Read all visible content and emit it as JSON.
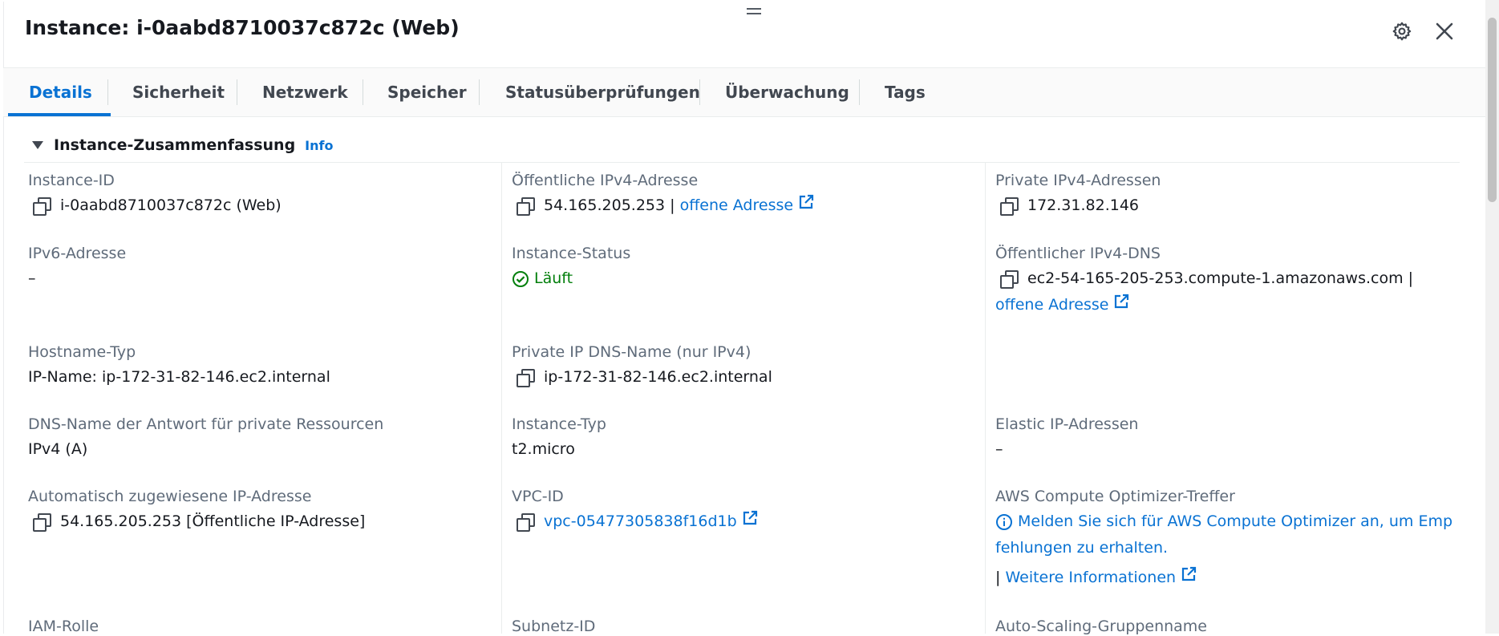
{
  "header": {
    "title": "Instance: i-0aabd8710037c872c (Web)"
  },
  "tabs": [
    {
      "label": "Details"
    },
    {
      "label": "Sicherheit"
    },
    {
      "label": "Netzwerk"
    },
    {
      "label": "Speicher"
    },
    {
      "label": "Statusüberprüfungen"
    },
    {
      "label": "Überwachung"
    },
    {
      "label": "Tags"
    }
  ],
  "section": {
    "title": "Instance-Zusammenfassung",
    "info": "Info"
  },
  "fields": {
    "instance_id": {
      "label": "Instance-ID",
      "value": "i-0aabd8710037c872c (Web)"
    },
    "public_ipv4": {
      "label": "Öffentliche IPv4-Adresse",
      "value": "54.165.205.253 |",
      "link": "offene Adresse"
    },
    "private_ipv4": {
      "label": "Private IPv4-Adressen",
      "value": "172.31.82.146"
    },
    "ipv6": {
      "label": "IPv6-Adresse",
      "value": "–"
    },
    "instance_status": {
      "label": "Instance-Status",
      "value": "Läuft"
    },
    "public_dns": {
      "label": "Öffentlicher IPv4-DNS",
      "value": "ec2-54-165-205-253.compute-1.amazonaws.com |",
      "link": "offene Adresse"
    },
    "hostname_type": {
      "label": "Hostname-Typ",
      "value": "IP-Name: ip-172-31-82-146.ec2.internal"
    },
    "private_ip_dns": {
      "label": "Private IP DNS-Name (nur IPv4)",
      "value": "ip-172-31-82-146.ec2.internal"
    },
    "dns_resource": {
      "label": "DNS-Name der Antwort für private Ressourcen",
      "value": "IPv4 (A)"
    },
    "instance_type": {
      "label": "Instance-Typ",
      "value": "t2.micro"
    },
    "elastic_ip": {
      "label": "Elastic IP-Adressen",
      "value": "–"
    },
    "auto_ip": {
      "label": "Automatisch zugewiesene IP-Adresse",
      "value": "54.165.205.253 [Öffentliche IP-Adresse]"
    },
    "vpc_id": {
      "label": "VPC-ID",
      "value": "vpc-05477305838f16d1b"
    },
    "optimizer": {
      "label": "AWS Compute Optimizer-Treffer",
      "line1": "Melden Sie sich für AWS Compute Optimizer an, um Emp",
      "line2": "fehlungen zu erhalten.",
      "more_prefix": "|",
      "more": "Weitere Informationen"
    },
    "iam_role": {
      "label": "IAM-Rolle"
    },
    "subnet_id": {
      "label": "Subnetz-ID"
    },
    "asg_name": {
      "label": "Auto-Scaling-Gruppenname"
    }
  },
  "colors": {
    "link": "#0972d3",
    "success": "#037f0c",
    "text": "#16191f",
    "label": "#5f6b7a"
  },
  "icons": [
    "settings-gear-icon",
    "close-icon",
    "copy-icon",
    "external-link-icon",
    "check-circle-icon",
    "info-circle-icon",
    "caret-down-icon",
    "drag-handle-icon"
  ]
}
